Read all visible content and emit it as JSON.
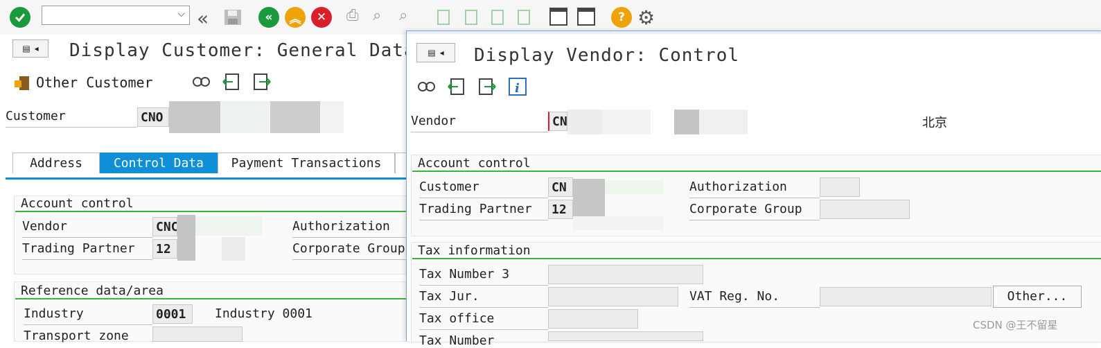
{
  "toolbar": {
    "command_field": {
      "value": "",
      "placeholder": ""
    },
    "icons": [
      "check-icon",
      "double-left-icon",
      "save-icon",
      "back-icon",
      "exit-icon",
      "cancel-icon",
      "print-icon",
      "find-icon",
      "find-next-icon",
      "first-page-icon",
      "prev-page-icon",
      "next-page-icon",
      "last-page-icon",
      "new-session-icon",
      "shortcut-icon",
      "help-icon",
      "settings-icon"
    ],
    "help_glyph": "?",
    "cancel_glyph": "✕"
  },
  "customer_screen": {
    "title": "Display Customer: General Data",
    "other_customer": "Other Customer",
    "customer_label": "Customer",
    "customer_value": "CNO",
    "tabs": [
      {
        "label": "Address",
        "active": false
      },
      {
        "label": "Control Data",
        "active": true
      },
      {
        "label": "Payment Transactions",
        "active": false
      }
    ],
    "account_control": {
      "header": "Account control",
      "vendor_label": "Vendor",
      "vendor_value": "CNC",
      "trading_partner_label": "Trading Partner",
      "trading_partner_value": "12",
      "authorization_label": "Authorization",
      "corporate_group_label": "Corporate Group"
    },
    "reference": {
      "header": "Reference data/area",
      "industry_label": "Industry",
      "industry_value": "0001",
      "industry_text": "Industry 0001",
      "transport_zone_label": "Transport zone"
    }
  },
  "vendor_popup": {
    "title": "Display Vendor: Control",
    "vendor_label": "Vendor",
    "vendor_value": "CN",
    "city": "北京",
    "account_control": {
      "header": "Account control",
      "customer_label": "Customer",
      "customer_value": "CN",
      "trading_partner_label": "Trading Partner",
      "trading_partner_value": "12",
      "authorization_label": "Authorization",
      "corporate_group_label": "Corporate Group"
    },
    "tax": {
      "header": "Tax information",
      "tax_number_3_label": "Tax Number 3",
      "tax_jur_label": "Tax Jur.",
      "vat_reg_label": "VAT Reg. No.",
      "other_button": "Other...",
      "tax_office_label": "Tax office",
      "tax_number_label": "Tax Number"
    }
  },
  "watermark": "CSDN @王不留星",
  "colors": {
    "accent_blue": "#0e8fd8",
    "section_green": "#3cb43c",
    "ok_green": "#1a9a3a",
    "back_orange": "#f0a20a",
    "cancel_red": "#d7202a"
  }
}
